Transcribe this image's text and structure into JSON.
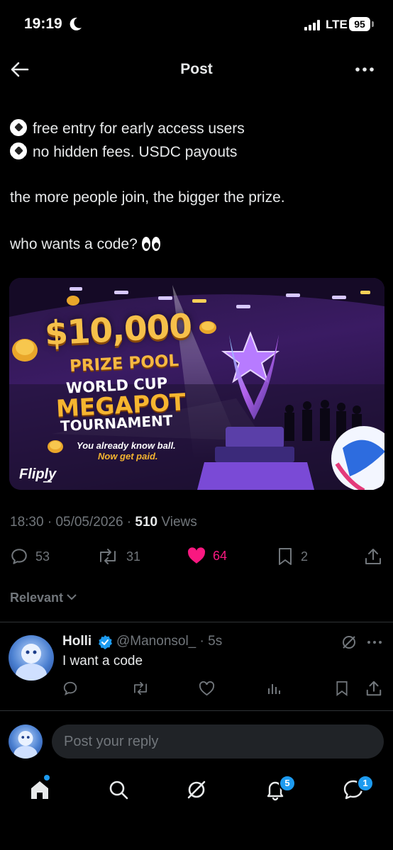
{
  "status_bar": {
    "time": "19:19",
    "network": "LTE",
    "battery": "95"
  },
  "header": {
    "title": "Post"
  },
  "post": {
    "lines": [
      "free entry for early access users",
      "no hidden fees. USDC payouts",
      "the more people join, the bigger the prize.",
      "who wants a code?"
    ],
    "image": {
      "prize": "$10,000",
      "pool": "PRIZE POOL",
      "line1": "WORLD CUP",
      "line2": "MEGAPOT",
      "line3": "TOURNAMENT",
      "tagline1": "You already know ball.",
      "tagline2": "Now get paid.",
      "logo": "Flipl͟y"
    },
    "time": "18:30",
    "date": "05/05/2026",
    "views_count": "510",
    "views_label": "Views",
    "replies": "53",
    "reposts": "31",
    "likes": "64",
    "bookmarks": "2"
  },
  "sort": {
    "label": "Relevant"
  },
  "reply": {
    "name": "Holli",
    "handle": "@Manonsol_",
    "age": "· 5s",
    "text": "I want a code"
  },
  "composer": {
    "placeholder": "Post your reply"
  },
  "bottom_nav": {
    "notifications_badge": "5",
    "messages_badge": "1"
  },
  "colors": {
    "accent": "#1d9bf0",
    "like": "#f91880",
    "muted": "#71767b",
    "text": "#e7e9ea"
  }
}
